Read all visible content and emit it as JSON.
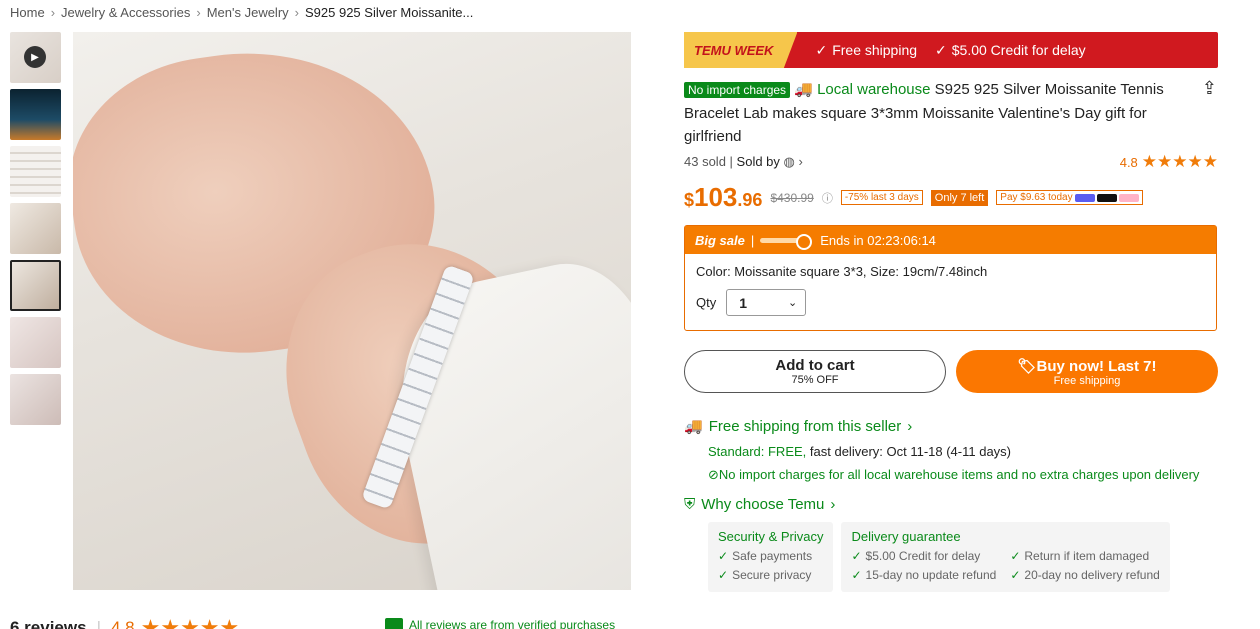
{
  "breadcrumb": [
    "Home",
    "Jewelry & Accessories",
    "Men's Jewelry",
    "S925 925 Silver Moissanite..."
  ],
  "promo": {
    "tag": "TEMU WEEK",
    "item1": "Free shipping",
    "item2": "$5.00 Credit for delay"
  },
  "product": {
    "badge": "No import charges",
    "local": "Local warehouse",
    "title": "S925 925 Silver Moissanite Tennis Bracelet Lab makes square 3*3mm Moissanite Valentine's Day gift for girlfriend",
    "sold": "43 sold",
    "sold_by": "Sold by",
    "rating": "4.8",
    "stars": "★★★★★"
  },
  "price": {
    "currency": "$",
    "whole": "103",
    "cents": ".96",
    "old": "$430.99",
    "discount": "-75% last 3 days",
    "stock": "Only 7 left",
    "pay": "Pay $9.63 today"
  },
  "sale": {
    "label": "Big sale",
    "ends": "Ends in 02:23:06:14",
    "progress": 0.85,
    "options": "Color: Moissanite square 3*3, Size: 19cm/7.48inch",
    "qty_label": "Qty",
    "qty_value": "1"
  },
  "buttons": {
    "cart": "Add to cart",
    "cart_sub": "75% OFF",
    "buy": "Buy now! Last 7!",
    "buy_sub": "Free shipping"
  },
  "shipping": {
    "title": "Free shipping from this seller",
    "standard_label": "Standard: FREE,",
    "standard_rest": "fast delivery: Oct 11-18 (4-11 days)",
    "note": "No import charges for all local warehouse items and no extra charges upon delivery"
  },
  "why": {
    "title": "Why choose Temu",
    "security_title": "Security & Privacy",
    "security_items": [
      "Safe payments",
      "Secure privacy"
    ],
    "delivery_title": "Delivery guarantee",
    "delivery_items": [
      "$5.00 Credit for delay",
      "Return if item damaged",
      "15-day no update refund",
      "20-day no delivery refund"
    ]
  },
  "reviews": {
    "count": "6 reviews",
    "rating": "4.8",
    "stars": "★★★★★",
    "verified": "All reviews are from verified purchases"
  },
  "colors": {
    "accent": "#fb7701",
    "green": "#0a8a1a",
    "promo_red": "#d0191f"
  }
}
